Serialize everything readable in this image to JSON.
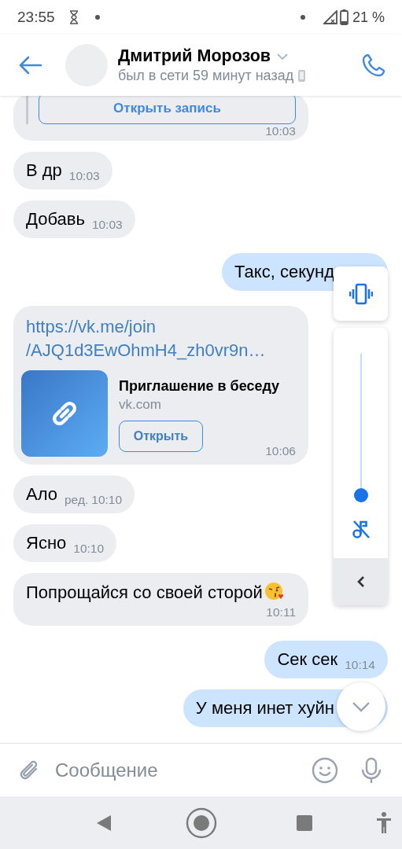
{
  "status_bar": {
    "time": "23:55",
    "battery": "21 %"
  },
  "header": {
    "name": "Дмитрий Морозов",
    "status": "был в сети 59 минут назад"
  },
  "messages": [
    {
      "kind": "post",
      "button": "Открыть запись",
      "time": "10:03"
    },
    {
      "kind": "incoming",
      "text": "В др",
      "time": "10:03"
    },
    {
      "kind": "incoming",
      "text": "Добавь",
      "time": "10:03"
    },
    {
      "kind": "outgoing",
      "text": "Такс, секунд"
    },
    {
      "kind": "link",
      "lines": [
        "https://vk.me/join",
        "/AJQ1d3EwOhmH4_zh0vr9n…"
      ],
      "title": "Приглашение в беседу",
      "domain": "vk.com",
      "button": "Открыть",
      "time": "10:06"
    },
    {
      "kind": "incoming",
      "text": "Ало",
      "edited": "ред.",
      "time": "10:10"
    },
    {
      "kind": "incoming",
      "text": "Ясно",
      "time": "10:10"
    },
    {
      "kind": "incoming",
      "text": "Попрощайся со своей сторой",
      "emoji": true,
      "time": "10:11"
    },
    {
      "kind": "outgoing",
      "text": "Сек сек",
      "time": "10:14"
    },
    {
      "kind": "outgoing",
      "text": "У меня инет хуйн"
    }
  ],
  "composer": {
    "placeholder": "Сообщение"
  },
  "volume_panel": {
    "level": 0.0
  }
}
